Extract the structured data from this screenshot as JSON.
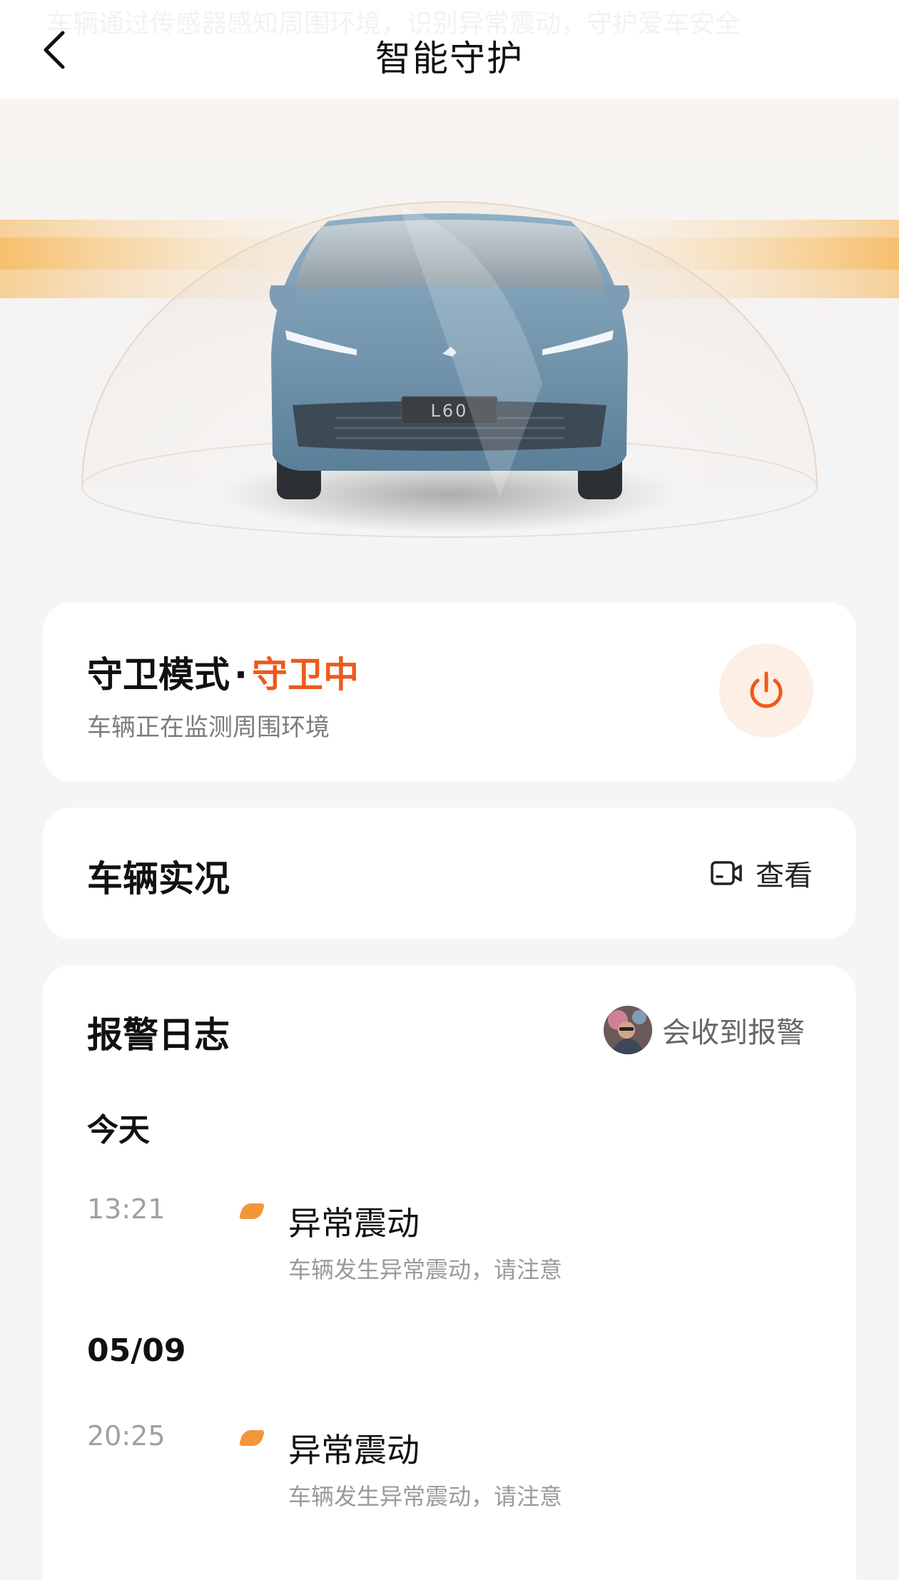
{
  "header": {
    "title": "智能守护",
    "ghost_text": "车辆通过传感器感知周围环境，识别异常震动，守护爱车安全"
  },
  "hero": {
    "plate": "L60"
  },
  "guard": {
    "label": "守卫模式",
    "separator": "·",
    "status": "守卫中",
    "subtitle": "车辆正在监测周围环境",
    "status_color": "#ee5a1c"
  },
  "live": {
    "title": "车辆实况",
    "view_label": "查看"
  },
  "log": {
    "title": "报警日志",
    "receive_label": "会收到报警",
    "groups": [
      {
        "date": "今天",
        "entries": [
          {
            "time": "13:21",
            "title": "异常震动",
            "desc": "车辆发生异常震动，请注意"
          }
        ]
      },
      {
        "date": "05/09",
        "entries": [
          {
            "time": "20:25",
            "title": "异常震动",
            "desc": "车辆发生异常震动，请注意"
          }
        ]
      }
    ],
    "marker_color": "#f3963a"
  },
  "icons": {
    "back": "chevron-left-icon",
    "power": "power-icon",
    "camera": "video-camera-icon"
  }
}
